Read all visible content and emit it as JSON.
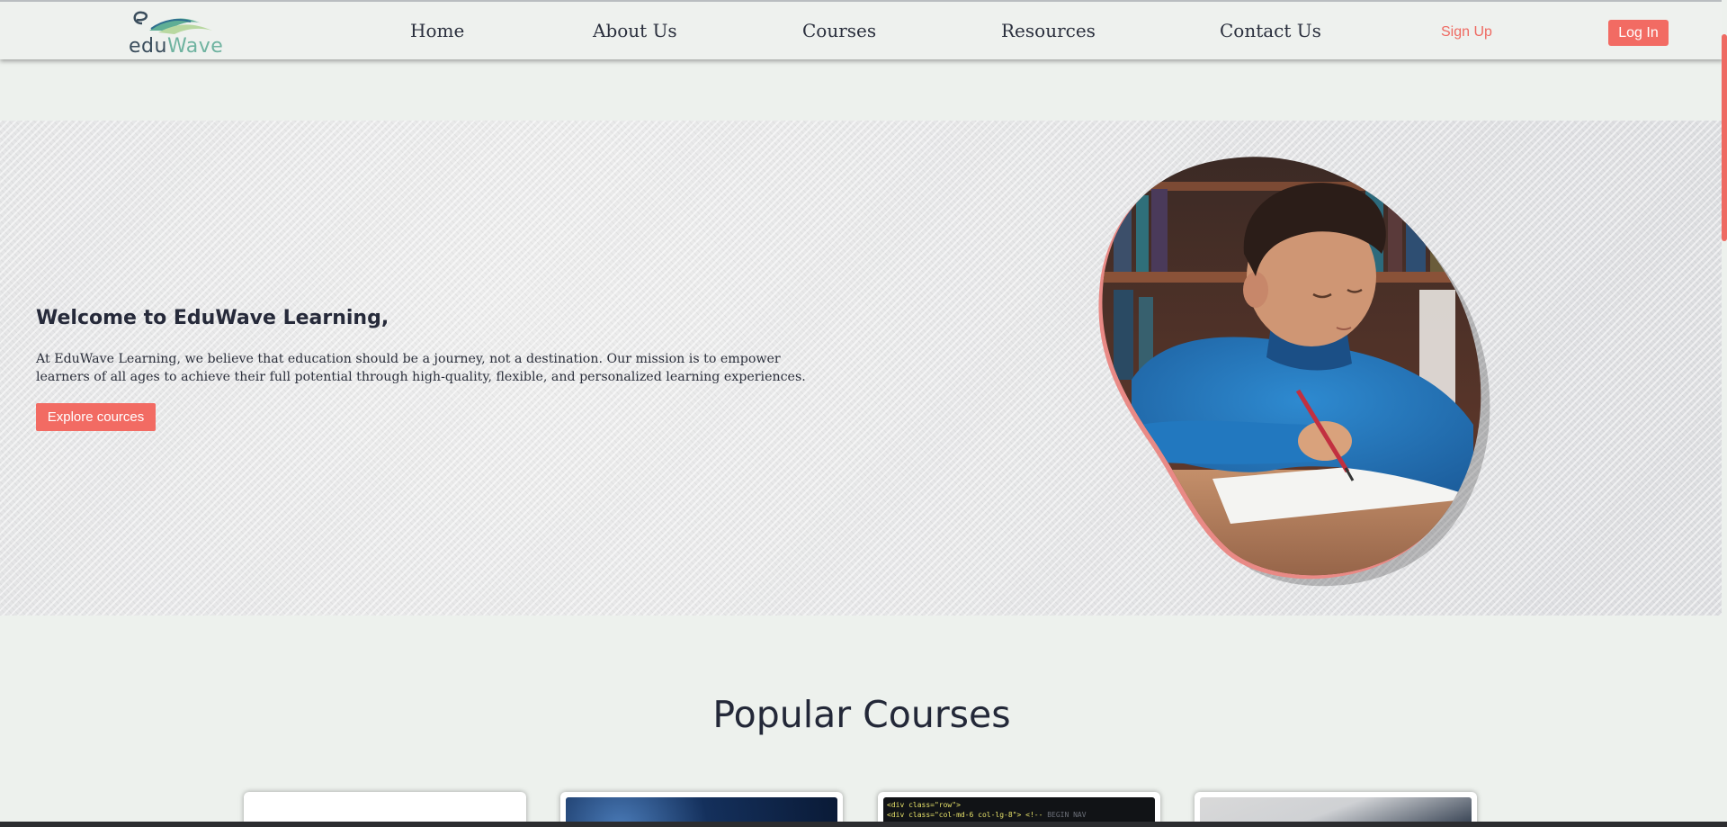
{
  "brand": {
    "logo_prefix": "edu",
    "logo_suffix": "Wave",
    "colors": {
      "accent": "#f26b63",
      "logo_dark": "#3a4d5c",
      "logo_green": "#6fb3a0"
    }
  },
  "nav": {
    "links": [
      "Home",
      "About Us",
      "Courses",
      "Resources",
      "Contact Us"
    ],
    "signup_label": "Sign Up",
    "login_label": "Log In"
  },
  "hero": {
    "title": "Welcome to EduWave Learning,",
    "text": "At EduWave Learning, we believe that education should be a journey, not a destination. Our mission is to empower learners of all ages to achieve their full potential through high-quality, flexible, and personalized learning experiences.",
    "button_label": "Explore cources"
  },
  "courses": {
    "title": "Popular Courses",
    "card_count": 4
  },
  "code_snippet": {
    "line1": "<div class=\"row\">",
    "line2": "<div class=\"col-md-6 col-lg-8\"> <!--",
    "note": "BEGIN NAV"
  }
}
